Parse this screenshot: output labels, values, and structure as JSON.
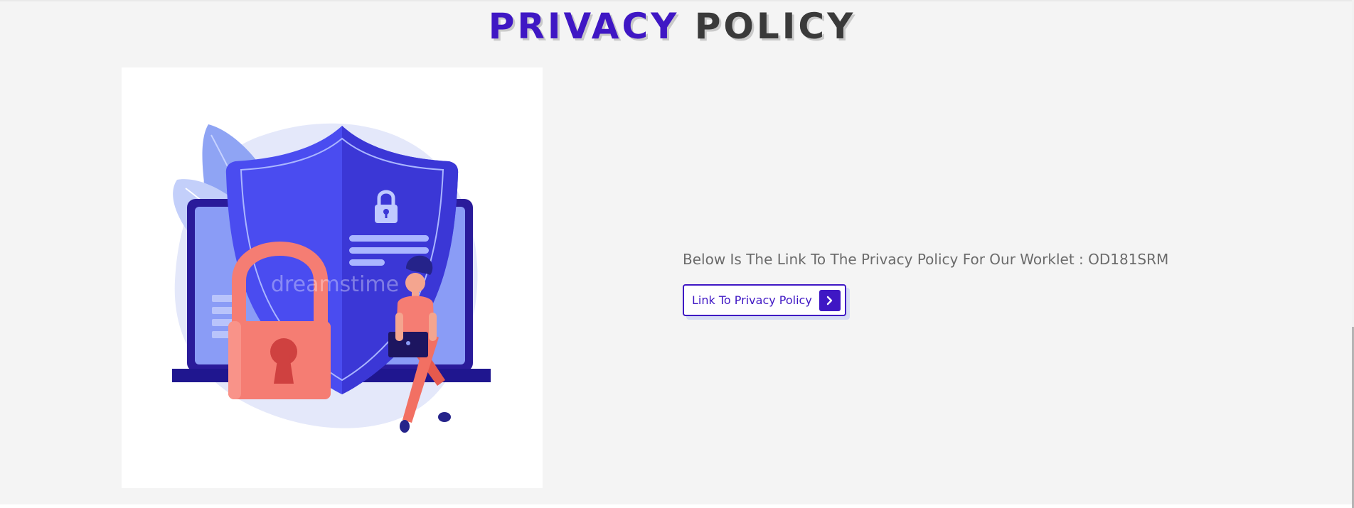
{
  "page": {
    "title_part1": "PRIVACY",
    "title_part2": "POLICY"
  },
  "illustration": {
    "icon": "privacy-shield-illustration",
    "watermark": "dreamstime"
  },
  "content": {
    "description": "Below Is The Link To The Privacy Policy For Our Worklet : OD181SRM",
    "link_label": "Link To Privacy Policy",
    "link_icon": "chevron-right-icon"
  },
  "colors": {
    "accent": "#3f17c4",
    "title_dark": "#3a3a3a",
    "background": "#f4f4f4",
    "text_muted": "#6b6b6b",
    "shield_blue": "#4a4cf0",
    "lock_coral": "#f57d73"
  }
}
